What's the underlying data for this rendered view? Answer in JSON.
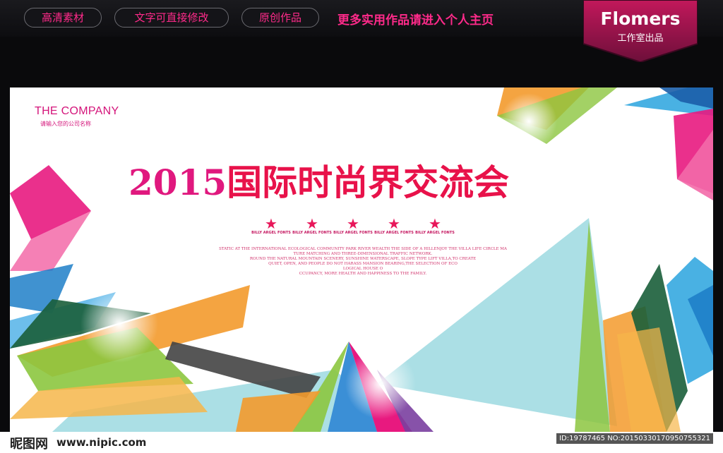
{
  "top_tabs": [
    {
      "label": "高清素材"
    },
    {
      "label": "文字可直接修改"
    },
    {
      "label": "原创作品"
    }
  ],
  "top_note": "更多实用作品请进入个人主页",
  "brand": {
    "title": "Flomers",
    "subtitle": "工作室出品"
  },
  "poster": {
    "company": "THE COMPANY",
    "company_sub": "请输入您的公司名称",
    "headline_year": "2015",
    "headline_text": "国际时尚界交流会",
    "stars": [
      {
        "glyph": "A",
        "label": "BILLY ARGEL FONTS"
      },
      {
        "glyph": "A",
        "label": "BILLY ARGEL FONTS"
      },
      {
        "glyph": "A",
        "label": "BILLY ARGEL FONTS"
      },
      {
        "glyph": "A",
        "label": "BILLY ARGEL FONTS"
      },
      {
        "glyph": "A",
        "label": "BILLY ARGEL FONTS"
      }
    ],
    "paragraph": [
      "STATIC AT THE INTERNATIONAL ECOLOGICAL COMMUNITY PARK RIVER WEALTH THE SIDE OF A HILLENJOY THE VILLA LIFE CIRCLE MA",
      "TURE MATCHING AND THREE-DIMENSIONAL TRAFFIC NETWORK.",
      "ROUND THE NATURAL MOUNTAIN SCENERY, SUNSHINE WATERSCAPE, SLOPE TYPE LIFT VILLA,TO CREATE",
      "QUIET, OPEN, AND PEOPLE DO NOT HARASS MANSION BEARING,THE SELECTION OF ECO",
      "LOGICAL HOUSE O",
      "CCUPANCY, MORE HEALTH AND HAPPINESS TO THE FAMILY."
    ]
  },
  "footer": {
    "logo": "昵图网",
    "url": "www.nipic.com",
    "id_text": "ID:19787465 NO:20150330170950755321"
  },
  "colors": {
    "accent": "#ff2a8a",
    "headline": "#e8124a"
  }
}
